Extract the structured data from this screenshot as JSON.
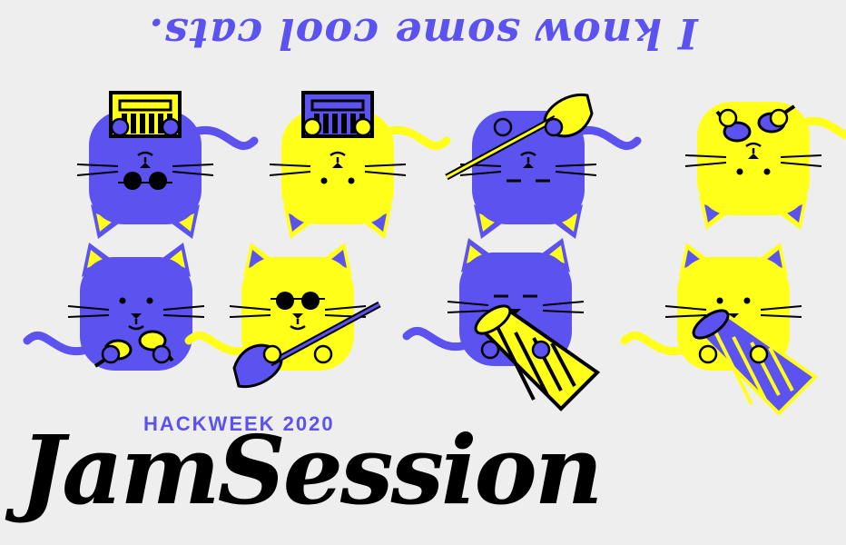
{
  "tagline": "I know some cool cats.",
  "event": "HACKWEEK 2020",
  "title": "JamSession",
  "colors": {
    "blue": "#5b52f0",
    "yellow": "#ffff1a",
    "background": "#eeeeee",
    "ink": "#000000"
  },
  "cats": [
    {
      "row": "top",
      "color": "blue",
      "instrument": "keyboard-icon",
      "eyes": "sunglasses"
    },
    {
      "row": "top",
      "color": "yellow",
      "instrument": "keyboard-icon",
      "eyes": "wink"
    },
    {
      "row": "top",
      "color": "blue",
      "instrument": "guitar-icon",
      "eyes": "closed"
    },
    {
      "row": "top",
      "color": "yellow",
      "instrument": "maracas-icon",
      "eyes": "dots"
    },
    {
      "row": "bottom",
      "color": "blue",
      "instrument": "maracas-icon",
      "eyes": "dots"
    },
    {
      "row": "bottom",
      "color": "yellow",
      "instrument": "guitar-icon",
      "eyes": "sunglasses"
    },
    {
      "row": "bottom",
      "color": "blue",
      "instrument": "drum-icon",
      "eyes": "sleepy"
    },
    {
      "row": "bottom",
      "color": "yellow",
      "instrument": "drum-icon",
      "eyes": "dots"
    }
  ]
}
